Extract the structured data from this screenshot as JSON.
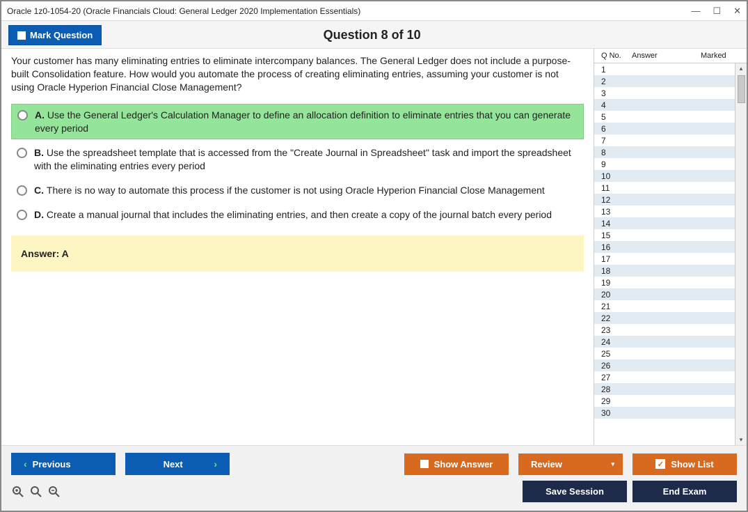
{
  "titlebar": {
    "text": "Oracle 1z0-1054-20 (Oracle Financials Cloud: General Ledger 2020 Implementation Essentials)"
  },
  "header": {
    "mark_label": "Mark Question",
    "title": "Question 8 of 10"
  },
  "question": {
    "text": "Your customer has many eliminating entries to eliminate intercompany balances. The General Ledger does not include a purpose-built Consolidation feature. How would you automate the process of creating eliminating entries, assuming your customer is not using Oracle Hyperion Financial Close Management?",
    "options": [
      {
        "letter": "A.",
        "text": "Use the General Ledger's Calculation Manager to define an allocation definition to eliminate entries that you can generate every period",
        "selected": true
      },
      {
        "letter": "B.",
        "text": "Use the spreadsheet template that is accessed from the \"Create Journal in Spreadsheet\" task and import the spreadsheet with the eliminating entries every period",
        "selected": false
      },
      {
        "letter": "C.",
        "text": "There is no way to automate this process if the customer is not using Oracle Hyperion Financial Close Management",
        "selected": false
      },
      {
        "letter": "D.",
        "text": "Create a manual journal that includes the eliminating entries, and then create a copy of the journal batch every period",
        "selected": false
      }
    ],
    "answer_label": "Answer: A"
  },
  "sidebar": {
    "headers": {
      "c1": "Q No.",
      "c2": "Answer",
      "c3": "Marked"
    },
    "rows": [
      {
        "n": "1"
      },
      {
        "n": "2"
      },
      {
        "n": "3"
      },
      {
        "n": "4"
      },
      {
        "n": "5"
      },
      {
        "n": "6"
      },
      {
        "n": "7"
      },
      {
        "n": "8"
      },
      {
        "n": "9"
      },
      {
        "n": "10"
      },
      {
        "n": "11"
      },
      {
        "n": "12"
      },
      {
        "n": "13"
      },
      {
        "n": "14"
      },
      {
        "n": "15"
      },
      {
        "n": "16"
      },
      {
        "n": "17"
      },
      {
        "n": "18"
      },
      {
        "n": "19"
      },
      {
        "n": "20"
      },
      {
        "n": "21"
      },
      {
        "n": "22"
      },
      {
        "n": "23"
      },
      {
        "n": "24"
      },
      {
        "n": "25"
      },
      {
        "n": "26"
      },
      {
        "n": "27"
      },
      {
        "n": "28"
      },
      {
        "n": "29"
      },
      {
        "n": "30"
      }
    ]
  },
  "footer": {
    "previous": "Previous",
    "next": "Next",
    "show_answer": "Show Answer",
    "review": "Review",
    "show_list": "Show List",
    "save_session": "Save Session",
    "end_exam": "End Exam"
  }
}
